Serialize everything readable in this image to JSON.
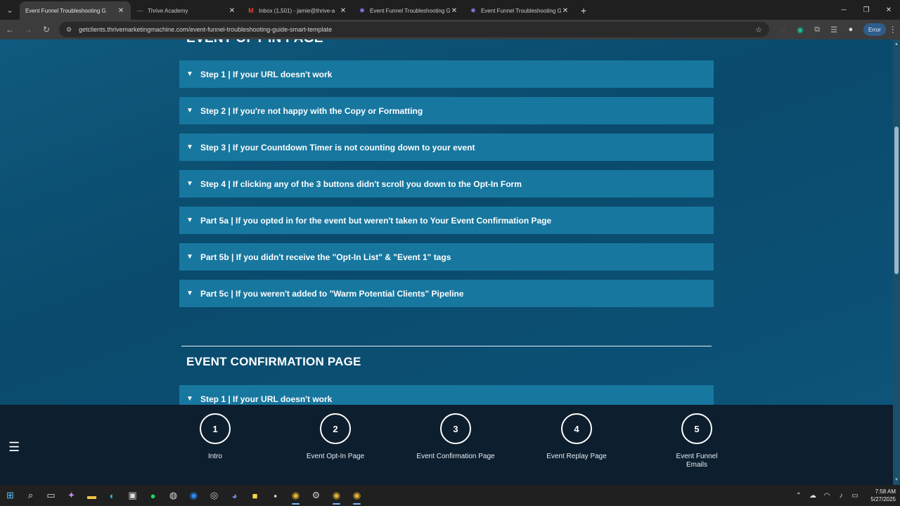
{
  "browser": {
    "tabs": [
      {
        "title": "Event Funnel Troubleshooting G",
        "icon": "page-icon",
        "active": true
      },
      {
        "title": "Thrive Academy",
        "icon": "page-icon",
        "active": false
      },
      {
        "title": "Inbox (1,501) - jamie@thrive-a",
        "icon": "gmail-icon",
        "active": false
      },
      {
        "title": "Event Funnel Troubleshooting G",
        "icon": "gear-favicon-icon",
        "active": false
      },
      {
        "title": "Event Funnel Troubleshooting G",
        "icon": "gear-favicon-icon",
        "active": false
      }
    ],
    "url": "getclients.thrivemarketingmachine.com/event-funnel-troubleshooting-guide-smart-template",
    "error_label": "Error"
  },
  "page": {
    "partial_heading": "EVENT OPT-IN PAGE",
    "optin_items": [
      "Step 1 | If your URL doesn't work",
      "Step 2 | If you're not happy with the Copy or Formatting",
      "Step 3 | If your Countdown Timer is not counting down to your event",
      "Step 4 | If clicking any of the 3 buttons didn't scroll you down to the Opt-In Form",
      "Part 5a | If you opted in for the event but weren't taken to Your Event Confirmation Page",
      "Part 5b | If you didn't receive the \"Opt-In List\" & \"Event 1\" tags",
      "Part 5c | If you weren't added to \"Warm Potential Clients\" Pipeline"
    ],
    "confirmation_heading": "EVENT CONFIRMATION PAGE",
    "confirmation_items": [
      "Step 1 | If your URL doesn't work"
    ]
  },
  "bottom_nav": {
    "steps": [
      {
        "number": "1",
        "label": "Intro"
      },
      {
        "number": "2",
        "label": "Event Opt-In Page"
      },
      {
        "number": "3",
        "label": "Event Confirmation Page"
      },
      {
        "number": "4",
        "label": "Event Replay Page"
      },
      {
        "number": "5",
        "label": "Event Funnel Emails"
      }
    ]
  },
  "taskbar": {
    "time": "7:58 AM",
    "date": "5/27/2025"
  },
  "colors": {
    "accordion_bg": "#17779f",
    "page_bg": "#0a4a6c",
    "bottom_nav_bg": "#0d1e2e"
  }
}
